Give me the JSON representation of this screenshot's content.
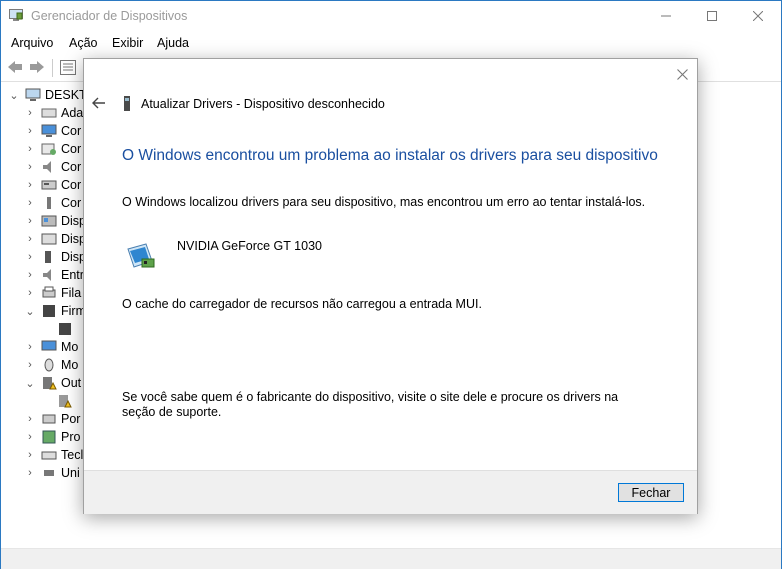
{
  "window": {
    "title": "Gerenciador de Dispositivos"
  },
  "menu": {
    "file": "Arquivo",
    "action": "Ação",
    "view": "Exibir",
    "help": "Ajuda"
  },
  "tree": {
    "root": "DESKTO",
    "items": [
      "Ada",
      "Cor",
      "Cor",
      "Cor",
      "Cor",
      "Cor",
      "Disp",
      "Disp",
      "Disp",
      "Entr",
      "Fila",
      "Firm",
      "",
      "Mo",
      "Mo",
      "Out",
      "",
      "Por",
      "Pro",
      "Tecl",
      "Uni"
    ]
  },
  "dialog": {
    "header": "Atualizar Drivers - Dispositivo desconhecido",
    "main_instruction": "O Windows encontrou um problema ao instalar os drivers para seu dispositivo",
    "message": "O Windows localizou drivers para seu dispositivo, mas encontrou um erro ao tentar instalá-los.",
    "device_name": "NVIDIA GeForce GT 1030",
    "error": "O cache do carregador de recursos não carregou a entrada MUI.",
    "help_text": "Se você sabe quem é o fabricante do dispositivo, visite o site dele e procure os drivers na seção de suporte.",
    "close_button": "Fechar"
  },
  "colors": {
    "accent": "#0078d7",
    "instruction": "#1a4fa0"
  }
}
